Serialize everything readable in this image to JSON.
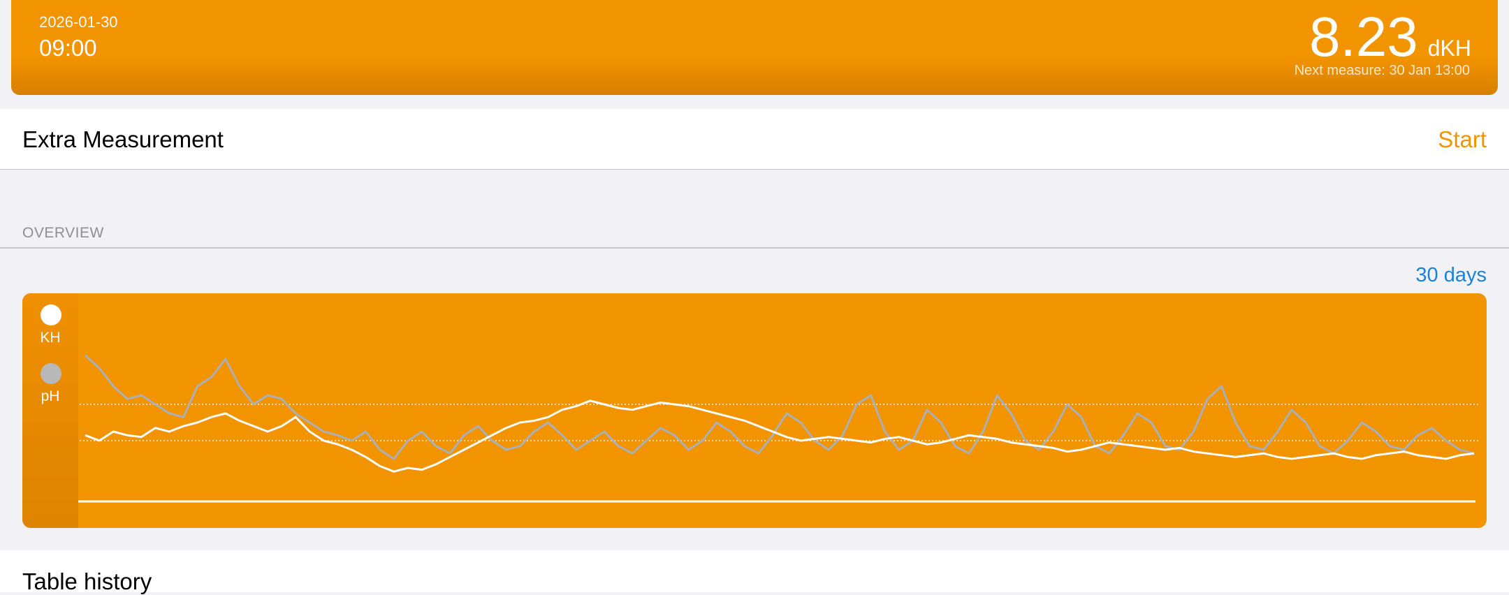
{
  "header": {
    "date": "2026-01-30",
    "time": "09:00",
    "value": "8.23",
    "unit": "dKH",
    "next_measure": "Next measure: 30 Jan 13:00"
  },
  "extra": {
    "label": "Extra Measurement",
    "action": "Start"
  },
  "overview": {
    "label": "OVERVIEW",
    "range": "30 days"
  },
  "legend": [
    {
      "label": "KH",
      "color": "#ffffff"
    },
    {
      "label": "pH",
      "color": "#b8b8b8"
    }
  ],
  "table": {
    "title": "Table history"
  },
  "colors": {
    "accent": "#f29300",
    "link": "#1a82d9",
    "kh_line": "#ffffff",
    "ph_line": "#aab0b8"
  },
  "chart_data": {
    "type": "line",
    "title": "",
    "xlabel": "",
    "ylabel": "",
    "y_reference_lines": [
      0.45,
      0.25
    ],
    "series": [
      {
        "name": "KH",
        "values": [
          0.28,
          0.25,
          0.3,
          0.28,
          0.27,
          0.32,
          0.3,
          0.33,
          0.35,
          0.38,
          0.4,
          0.36,
          0.33,
          0.3,
          0.33,
          0.38,
          0.3,
          0.25,
          0.23,
          0.2,
          0.16,
          0.11,
          0.08,
          0.1,
          0.09,
          0.12,
          0.16,
          0.2,
          0.24,
          0.28,
          0.32,
          0.35,
          0.36,
          0.38,
          0.42,
          0.44,
          0.47,
          0.45,
          0.43,
          0.42,
          0.44,
          0.46,
          0.45,
          0.44,
          0.42,
          0.4,
          0.38,
          0.36,
          0.33,
          0.3,
          0.27,
          0.25,
          0.26,
          0.27,
          0.26,
          0.25,
          0.24,
          0.26,
          0.27,
          0.25,
          0.23,
          0.24,
          0.26,
          0.28,
          0.27,
          0.26,
          0.24,
          0.23,
          0.22,
          0.21,
          0.19,
          0.2,
          0.22,
          0.24,
          0.23,
          0.22,
          0.21,
          0.2,
          0.21,
          0.19,
          0.18,
          0.17,
          0.16,
          0.17,
          0.18,
          0.16,
          0.15,
          0.16,
          0.17,
          0.18,
          0.16,
          0.15,
          0.17,
          0.18,
          0.19,
          0.17,
          0.16,
          0.15,
          0.17,
          0.18
        ],
        "color": "#ffffff"
      },
      {
        "name": "pH",
        "values": [
          0.72,
          0.65,
          0.55,
          0.48,
          0.5,
          0.45,
          0.4,
          0.38,
          0.55,
          0.6,
          0.7,
          0.55,
          0.45,
          0.5,
          0.48,
          0.4,
          0.35,
          0.3,
          0.28,
          0.25,
          0.3,
          0.2,
          0.15,
          0.25,
          0.3,
          0.22,
          0.18,
          0.28,
          0.33,
          0.25,
          0.2,
          0.22,
          0.3,
          0.35,
          0.28,
          0.2,
          0.25,
          0.3,
          0.22,
          0.18,
          0.25,
          0.32,
          0.28,
          0.2,
          0.25,
          0.35,
          0.3,
          0.22,
          0.18,
          0.28,
          0.4,
          0.35,
          0.25,
          0.2,
          0.28,
          0.45,
          0.5,
          0.3,
          0.2,
          0.25,
          0.42,
          0.35,
          0.22,
          0.18,
          0.3,
          0.5,
          0.4,
          0.25,
          0.2,
          0.3,
          0.45,
          0.38,
          0.22,
          0.18,
          0.28,
          0.4,
          0.35,
          0.22,
          0.2,
          0.3,
          0.48,
          0.55,
          0.35,
          0.22,
          0.2,
          0.3,
          0.42,
          0.35,
          0.22,
          0.18,
          0.25,
          0.35,
          0.3,
          0.22,
          0.2,
          0.28,
          0.32,
          0.25,
          0.2,
          0.18
        ],
        "color": "#aab0b8"
      }
    ]
  }
}
